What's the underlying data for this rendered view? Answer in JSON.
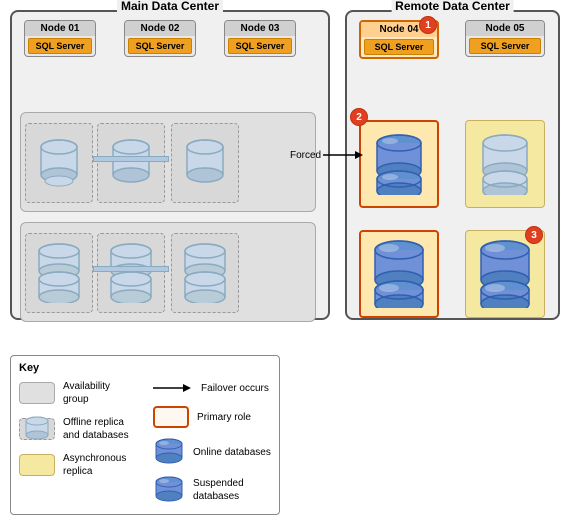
{
  "mainDC": {
    "label": "Main Data Center",
    "nodes": [
      {
        "id": "node01",
        "label": "Node 01",
        "sql": "SQL Server",
        "highlighted": false
      },
      {
        "id": "node02",
        "label": "Node 02",
        "sql": "SQL Server",
        "highlighted": false
      },
      {
        "id": "node03",
        "label": "Node 03",
        "sql": "SQL Server",
        "highlighted": false
      }
    ]
  },
  "remoteDC": {
    "label": "Remote Data Center",
    "nodes": [
      {
        "id": "node04",
        "label": "Node 04",
        "sql": "SQL Server",
        "highlighted": true
      },
      {
        "id": "node05",
        "label": "Node 05",
        "sql": "SQL Server",
        "highlighted": false
      }
    ]
  },
  "badges": [
    {
      "num": "1",
      "desc": "Node 04 badge"
    },
    {
      "num": "2",
      "desc": "Forced failover badge"
    },
    {
      "num": "3",
      "desc": "Node 05 replica badge"
    }
  ],
  "forcedLabel": "Forced",
  "key": {
    "title": "Key",
    "items": [
      {
        "icon": "ag",
        "text": "Availability group"
      },
      {
        "icon": "offline",
        "text": "Offline replica\nand databases"
      },
      {
        "icon": "async",
        "text": "Asynchronous replica"
      },
      {
        "icon": "arrow",
        "text": "Failover occurs"
      },
      {
        "icon": "primary",
        "text": "Primary role"
      },
      {
        "icon": "online-db",
        "text": "Online databases"
      },
      {
        "icon": "suspended-db",
        "text": "Suspended databases"
      }
    ]
  }
}
